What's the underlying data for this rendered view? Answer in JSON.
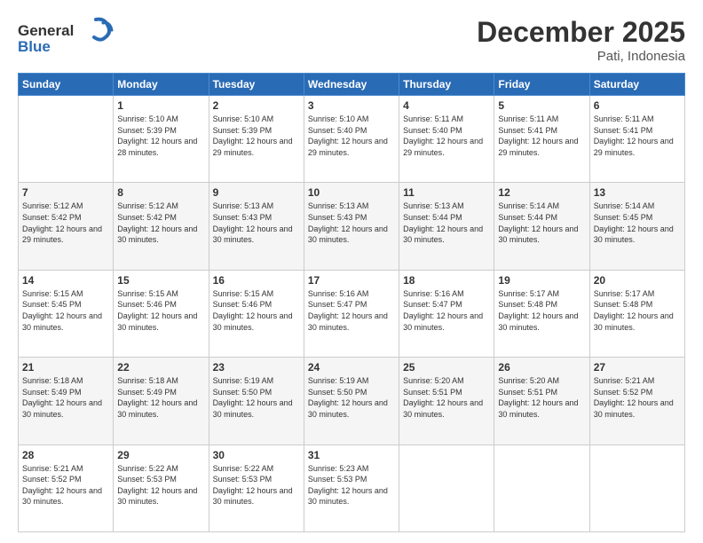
{
  "header": {
    "logo_general": "General",
    "logo_blue": "Blue",
    "month": "December 2025",
    "location": "Pati, Indonesia"
  },
  "weekdays": [
    "Sunday",
    "Monday",
    "Tuesday",
    "Wednesday",
    "Thursday",
    "Friday",
    "Saturday"
  ],
  "weeks": [
    [
      {
        "day": "",
        "sunrise": "",
        "sunset": "",
        "daylight": ""
      },
      {
        "day": "1",
        "sunrise": "Sunrise: 5:10 AM",
        "sunset": "Sunset: 5:39 PM",
        "daylight": "Daylight: 12 hours and 28 minutes."
      },
      {
        "day": "2",
        "sunrise": "Sunrise: 5:10 AM",
        "sunset": "Sunset: 5:39 PM",
        "daylight": "Daylight: 12 hours and 29 minutes."
      },
      {
        "day": "3",
        "sunrise": "Sunrise: 5:10 AM",
        "sunset": "Sunset: 5:40 PM",
        "daylight": "Daylight: 12 hours and 29 minutes."
      },
      {
        "day": "4",
        "sunrise": "Sunrise: 5:11 AM",
        "sunset": "Sunset: 5:40 PM",
        "daylight": "Daylight: 12 hours and 29 minutes."
      },
      {
        "day": "5",
        "sunrise": "Sunrise: 5:11 AM",
        "sunset": "Sunset: 5:41 PM",
        "daylight": "Daylight: 12 hours and 29 minutes."
      },
      {
        "day": "6",
        "sunrise": "Sunrise: 5:11 AM",
        "sunset": "Sunset: 5:41 PM",
        "daylight": "Daylight: 12 hours and 29 minutes."
      }
    ],
    [
      {
        "day": "7",
        "sunrise": "Sunrise: 5:12 AM",
        "sunset": "Sunset: 5:42 PM",
        "daylight": "Daylight: 12 hours and 29 minutes."
      },
      {
        "day": "8",
        "sunrise": "Sunrise: 5:12 AM",
        "sunset": "Sunset: 5:42 PM",
        "daylight": "Daylight: 12 hours and 30 minutes."
      },
      {
        "day": "9",
        "sunrise": "Sunrise: 5:13 AM",
        "sunset": "Sunset: 5:43 PM",
        "daylight": "Daylight: 12 hours and 30 minutes."
      },
      {
        "day": "10",
        "sunrise": "Sunrise: 5:13 AM",
        "sunset": "Sunset: 5:43 PM",
        "daylight": "Daylight: 12 hours and 30 minutes."
      },
      {
        "day": "11",
        "sunrise": "Sunrise: 5:13 AM",
        "sunset": "Sunset: 5:44 PM",
        "daylight": "Daylight: 12 hours and 30 minutes."
      },
      {
        "day": "12",
        "sunrise": "Sunrise: 5:14 AM",
        "sunset": "Sunset: 5:44 PM",
        "daylight": "Daylight: 12 hours and 30 minutes."
      },
      {
        "day": "13",
        "sunrise": "Sunrise: 5:14 AM",
        "sunset": "Sunset: 5:45 PM",
        "daylight": "Daylight: 12 hours and 30 minutes."
      }
    ],
    [
      {
        "day": "14",
        "sunrise": "Sunrise: 5:15 AM",
        "sunset": "Sunset: 5:45 PM",
        "daylight": "Daylight: 12 hours and 30 minutes."
      },
      {
        "day": "15",
        "sunrise": "Sunrise: 5:15 AM",
        "sunset": "Sunset: 5:46 PM",
        "daylight": "Daylight: 12 hours and 30 minutes."
      },
      {
        "day": "16",
        "sunrise": "Sunrise: 5:15 AM",
        "sunset": "Sunset: 5:46 PM",
        "daylight": "Daylight: 12 hours and 30 minutes."
      },
      {
        "day": "17",
        "sunrise": "Sunrise: 5:16 AM",
        "sunset": "Sunset: 5:47 PM",
        "daylight": "Daylight: 12 hours and 30 minutes."
      },
      {
        "day": "18",
        "sunrise": "Sunrise: 5:16 AM",
        "sunset": "Sunset: 5:47 PM",
        "daylight": "Daylight: 12 hours and 30 minutes."
      },
      {
        "day": "19",
        "sunrise": "Sunrise: 5:17 AM",
        "sunset": "Sunset: 5:48 PM",
        "daylight": "Daylight: 12 hours and 30 minutes."
      },
      {
        "day": "20",
        "sunrise": "Sunrise: 5:17 AM",
        "sunset": "Sunset: 5:48 PM",
        "daylight": "Daylight: 12 hours and 30 minutes."
      }
    ],
    [
      {
        "day": "21",
        "sunrise": "Sunrise: 5:18 AM",
        "sunset": "Sunset: 5:49 PM",
        "daylight": "Daylight: 12 hours and 30 minutes."
      },
      {
        "day": "22",
        "sunrise": "Sunrise: 5:18 AM",
        "sunset": "Sunset: 5:49 PM",
        "daylight": "Daylight: 12 hours and 30 minutes."
      },
      {
        "day": "23",
        "sunrise": "Sunrise: 5:19 AM",
        "sunset": "Sunset: 5:50 PM",
        "daylight": "Daylight: 12 hours and 30 minutes."
      },
      {
        "day": "24",
        "sunrise": "Sunrise: 5:19 AM",
        "sunset": "Sunset: 5:50 PM",
        "daylight": "Daylight: 12 hours and 30 minutes."
      },
      {
        "day": "25",
        "sunrise": "Sunrise: 5:20 AM",
        "sunset": "Sunset: 5:51 PM",
        "daylight": "Daylight: 12 hours and 30 minutes."
      },
      {
        "day": "26",
        "sunrise": "Sunrise: 5:20 AM",
        "sunset": "Sunset: 5:51 PM",
        "daylight": "Daylight: 12 hours and 30 minutes."
      },
      {
        "day": "27",
        "sunrise": "Sunrise: 5:21 AM",
        "sunset": "Sunset: 5:52 PM",
        "daylight": "Daylight: 12 hours and 30 minutes."
      }
    ],
    [
      {
        "day": "28",
        "sunrise": "Sunrise: 5:21 AM",
        "sunset": "Sunset: 5:52 PM",
        "daylight": "Daylight: 12 hours and 30 minutes."
      },
      {
        "day": "29",
        "sunrise": "Sunrise: 5:22 AM",
        "sunset": "Sunset: 5:53 PM",
        "daylight": "Daylight: 12 hours and 30 minutes."
      },
      {
        "day": "30",
        "sunrise": "Sunrise: 5:22 AM",
        "sunset": "Sunset: 5:53 PM",
        "daylight": "Daylight: 12 hours and 30 minutes."
      },
      {
        "day": "31",
        "sunrise": "Sunrise: 5:23 AM",
        "sunset": "Sunset: 5:53 PM",
        "daylight": "Daylight: 12 hours and 30 minutes."
      },
      {
        "day": "",
        "sunrise": "",
        "sunset": "",
        "daylight": ""
      },
      {
        "day": "",
        "sunrise": "",
        "sunset": "",
        "daylight": ""
      },
      {
        "day": "",
        "sunrise": "",
        "sunset": "",
        "daylight": ""
      }
    ]
  ]
}
